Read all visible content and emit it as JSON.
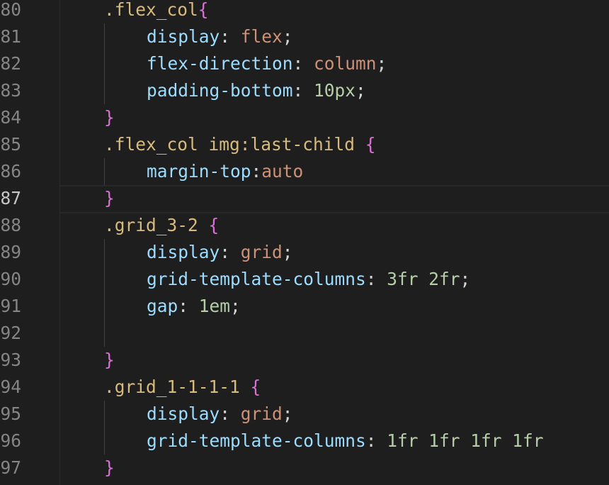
{
  "editor": {
    "active_line": "87",
    "lines": [
      {
        "num": "80",
        "tokens": [
          {
            "t": ".flex_col",
            "c": "sel"
          },
          {
            "t": "{",
            "c": "brace"
          }
        ]
      },
      {
        "num": "81",
        "tokens": [
          {
            "t": "display",
            "c": "prop"
          },
          {
            "t": ": ",
            "c": "punc"
          },
          {
            "t": "flex",
            "c": "val"
          },
          {
            "t": ";",
            "c": "punc"
          }
        ]
      },
      {
        "num": "82",
        "tokens": [
          {
            "t": "flex-direction",
            "c": "prop"
          },
          {
            "t": ": ",
            "c": "punc"
          },
          {
            "t": "column",
            "c": "val"
          },
          {
            "t": ";",
            "c": "punc"
          }
        ]
      },
      {
        "num": "83",
        "tokens": [
          {
            "t": "padding-bottom",
            "c": "prop"
          },
          {
            "t": ": ",
            "c": "punc"
          },
          {
            "t": "10px",
            "c": "num"
          },
          {
            "t": ";",
            "c": "punc"
          }
        ]
      },
      {
        "num": "84",
        "tokens": [
          {
            "t": "}",
            "c": "brace"
          }
        ]
      },
      {
        "num": "85",
        "tokens": [
          {
            "t": ".flex_col img:last-child ",
            "c": "sel"
          },
          {
            "t": "{",
            "c": "brace"
          }
        ]
      },
      {
        "num": "86",
        "tokens": [
          {
            "t": "margin-top",
            "c": "prop"
          },
          {
            "t": ":",
            "c": "punc"
          },
          {
            "t": "auto",
            "c": "val"
          }
        ]
      },
      {
        "num": "87",
        "tokens": [
          {
            "t": "}",
            "c": "brace"
          }
        ]
      },
      {
        "num": "88",
        "tokens": [
          {
            "t": ".grid_3-2 ",
            "c": "sel"
          },
          {
            "t": "{",
            "c": "brace"
          }
        ]
      },
      {
        "num": "89",
        "tokens": [
          {
            "t": "display",
            "c": "prop"
          },
          {
            "t": ": ",
            "c": "punc"
          },
          {
            "t": "grid",
            "c": "val"
          },
          {
            "t": ";",
            "c": "punc"
          }
        ]
      },
      {
        "num": "90",
        "tokens": [
          {
            "t": "grid-template-columns",
            "c": "prop"
          },
          {
            "t": ": ",
            "c": "punc"
          },
          {
            "t": "3fr 2fr",
            "c": "num"
          },
          {
            "t": ";",
            "c": "punc"
          }
        ]
      },
      {
        "num": "91",
        "tokens": [
          {
            "t": "gap",
            "c": "prop"
          },
          {
            "t": ": ",
            "c": "punc"
          },
          {
            "t": "1em",
            "c": "num"
          },
          {
            "t": ";",
            "c": "punc"
          }
        ]
      },
      {
        "num": "92",
        "tokens": []
      },
      {
        "num": "93",
        "tokens": [
          {
            "t": "}",
            "c": "brace"
          }
        ]
      },
      {
        "num": "94",
        "tokens": [
          {
            "t": ".grid_1-1-1-1 ",
            "c": "sel"
          },
          {
            "t": "{",
            "c": "brace"
          }
        ]
      },
      {
        "num": "95",
        "tokens": [
          {
            "t": "display",
            "c": "prop"
          },
          {
            "t": ": ",
            "c": "punc"
          },
          {
            "t": "grid",
            "c": "val"
          },
          {
            "t": ";",
            "c": "punc"
          }
        ]
      },
      {
        "num": "96",
        "tokens": [
          {
            "t": "grid-template-columns",
            "c": "prop"
          },
          {
            "t": ": ",
            "c": "punc"
          },
          {
            "t": "1fr 1fr 1fr 1fr",
            "c": "num"
          }
        ]
      },
      {
        "num": "97",
        "tokens": [
          {
            "t": "}",
            "c": "brace"
          }
        ]
      }
    ]
  },
  "colors": {
    "background": "#1e1e1e",
    "line_number": "#858585",
    "active_line_number": "#c6c6c6",
    "selector": "#d7ba7d",
    "brace": "#da70d6",
    "property": "#9cdcfe",
    "value_keyword": "#ce9178",
    "value_number": "#b5cea8"
  }
}
